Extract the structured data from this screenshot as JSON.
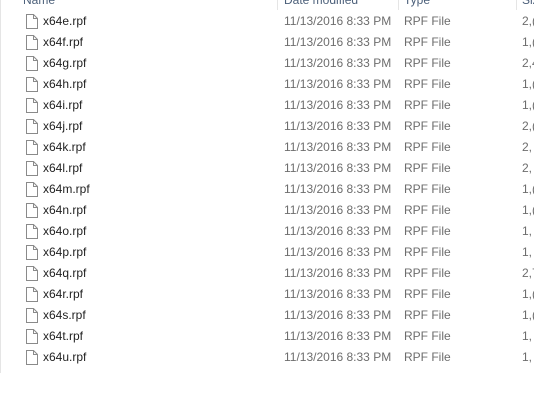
{
  "columns": {
    "name": "Name",
    "date_modified": "Date modified",
    "type": "Type",
    "size": "Siz"
  },
  "files": [
    {
      "name": "x64e.rpf",
      "date": "11/13/2016 8:33 PM",
      "type": "RPF File",
      "size": "2,("
    },
    {
      "name": "x64f.rpf",
      "date": "11/13/2016 8:33 PM",
      "type": "RPF File",
      "size": "1,("
    },
    {
      "name": "x64g.rpf",
      "date": "11/13/2016 8:33 PM",
      "type": "RPF File",
      "size": "2,4"
    },
    {
      "name": "x64h.rpf",
      "date": "11/13/2016 8:33 PM",
      "type": "RPF File",
      "size": "1,("
    },
    {
      "name": "x64i.rpf",
      "date": "11/13/2016 8:33 PM",
      "type": "RPF File",
      "size": "1,("
    },
    {
      "name": "x64j.rpf",
      "date": "11/13/2016 8:33 PM",
      "type": "RPF File",
      "size": "2,("
    },
    {
      "name": "x64k.rpf",
      "date": "11/13/2016 8:33 PM",
      "type": "RPF File",
      "size": "2,"
    },
    {
      "name": "x64l.rpf",
      "date": "11/13/2016 8:33 PM",
      "type": "RPF File",
      "size": "2,"
    },
    {
      "name": "x64m.rpf",
      "date": "11/13/2016 8:33 PM",
      "type": "RPF File",
      "size": "1,("
    },
    {
      "name": "x64n.rpf",
      "date": "11/13/2016 8:33 PM",
      "type": "RPF File",
      "size": "1,("
    },
    {
      "name": "x64o.rpf",
      "date": "11/13/2016 8:33 PM",
      "type": "RPF File",
      "size": "1,"
    },
    {
      "name": "x64p.rpf",
      "date": "11/13/2016 8:33 PM",
      "type": "RPF File",
      "size": "1,"
    },
    {
      "name": "x64q.rpf",
      "date": "11/13/2016 8:33 PM",
      "type": "RPF File",
      "size": "2,7"
    },
    {
      "name": "x64r.rpf",
      "date": "11/13/2016 8:33 PM",
      "type": "RPF File",
      "size": "1,("
    },
    {
      "name": "x64s.rpf",
      "date": "11/13/2016 8:33 PM",
      "type": "RPF File",
      "size": "1,("
    },
    {
      "name": "x64t.rpf",
      "date": "11/13/2016 8:33 PM",
      "type": "RPF File",
      "size": "1,"
    },
    {
      "name": "x64u.rpf",
      "date": "11/13/2016 8:33 PM",
      "type": "RPF File",
      "size": "1,"
    }
  ],
  "icon": "file-icon",
  "colors": {
    "header_text": "#4c607a",
    "name_text": "#1f1f1f",
    "detail_text": "#6d6d6d",
    "divider": "#e5e5e5"
  }
}
